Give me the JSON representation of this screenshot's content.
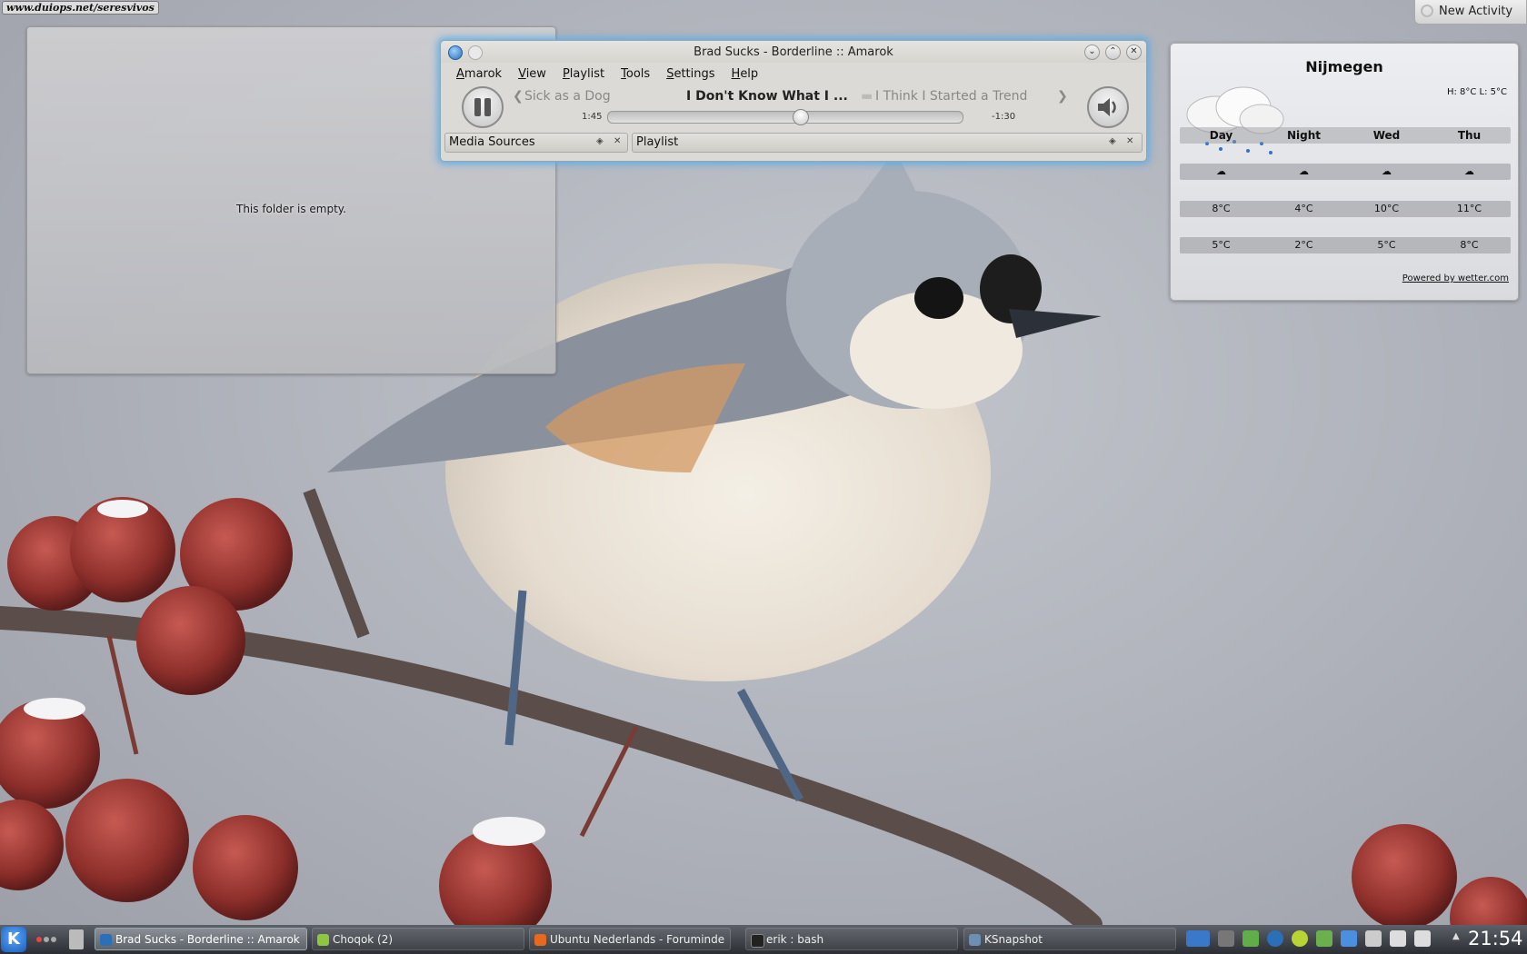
{
  "desktop": {
    "watermark": "www.duiops.net/seresvivos",
    "folder_view": {
      "empty_text": "This folder is empty."
    },
    "new_activity_label": "New Activity"
  },
  "amarok": {
    "title": "Brad Sucks - Borderline  ::  Amarok",
    "menu": [
      "Amarok",
      "View",
      "Playlist",
      "Tools",
      "Settings",
      "Help"
    ],
    "previous_track": "Sick as a Dog",
    "current_track": "I Don't Know What I ...",
    "next_track": "I Think I Started a Trend",
    "elapsed": "1:45",
    "remaining": "-1:30",
    "progress": 0.54,
    "panels": {
      "left": "Media Sources",
      "right": "Playlist"
    }
  },
  "weather": {
    "city": "Nijmegen",
    "high_low": "H: 8°C L: 5°C",
    "columns": [
      "Day",
      "Night",
      "Wed",
      "Thu"
    ],
    "icons": [
      "rain-cloud",
      "rain-cloud",
      "rain-cloud",
      "cloud"
    ],
    "highs": [
      "8°C",
      "4°C",
      "10°C",
      "11°C"
    ],
    "lows": [
      "5°C",
      "2°C",
      "5°C",
      "8°C"
    ],
    "powered_by": "Powered by wetter.com"
  },
  "taskbar": {
    "tasks": [
      {
        "label": "Brad Sucks - Borderline  ::  Amarok",
        "active": true,
        "icon_color": "#2a6fb8"
      },
      {
        "label": "Choqok (2)",
        "active": false,
        "icon_color": "#8ec641"
      },
      {
        "label": "Ubuntu Nederlands - Foruminde",
        "active": false,
        "icon_color": "#e7681f"
      },
      {
        "label": "erik : bash",
        "active": false,
        "icon_color": "#222222"
      },
      {
        "label": "KSnapshot",
        "active": false,
        "icon_color": "#6d8fb3"
      }
    ],
    "tray_icons": [
      "display-icon",
      "info-icon",
      "mail-icon",
      "network-icon",
      "updates-icon",
      "tools-icon",
      "download-icon",
      "scissors-icon",
      "volume-icon",
      "battery-icon"
    ],
    "clock": "21:54"
  }
}
